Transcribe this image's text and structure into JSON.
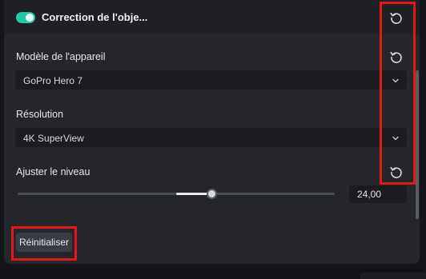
{
  "header": {
    "title": "Correction de l'obje...",
    "toggle_on": true,
    "accent": "#20c9a6"
  },
  "device_model": {
    "label": "Modèle de l'appareil",
    "value": "GoPro Hero 7"
  },
  "resolution": {
    "label": "Résolution",
    "value": "4K SuperView"
  },
  "level": {
    "label": "Ajuster le niveau",
    "value": "24,00",
    "slider_fraction": 0.61
  },
  "footer": {
    "reset_label": "Réinitialiser"
  },
  "icons": {
    "reset": "reset-icon",
    "dropdown": "chevron-down-icon"
  },
  "highlight_color": "#e3161c"
}
